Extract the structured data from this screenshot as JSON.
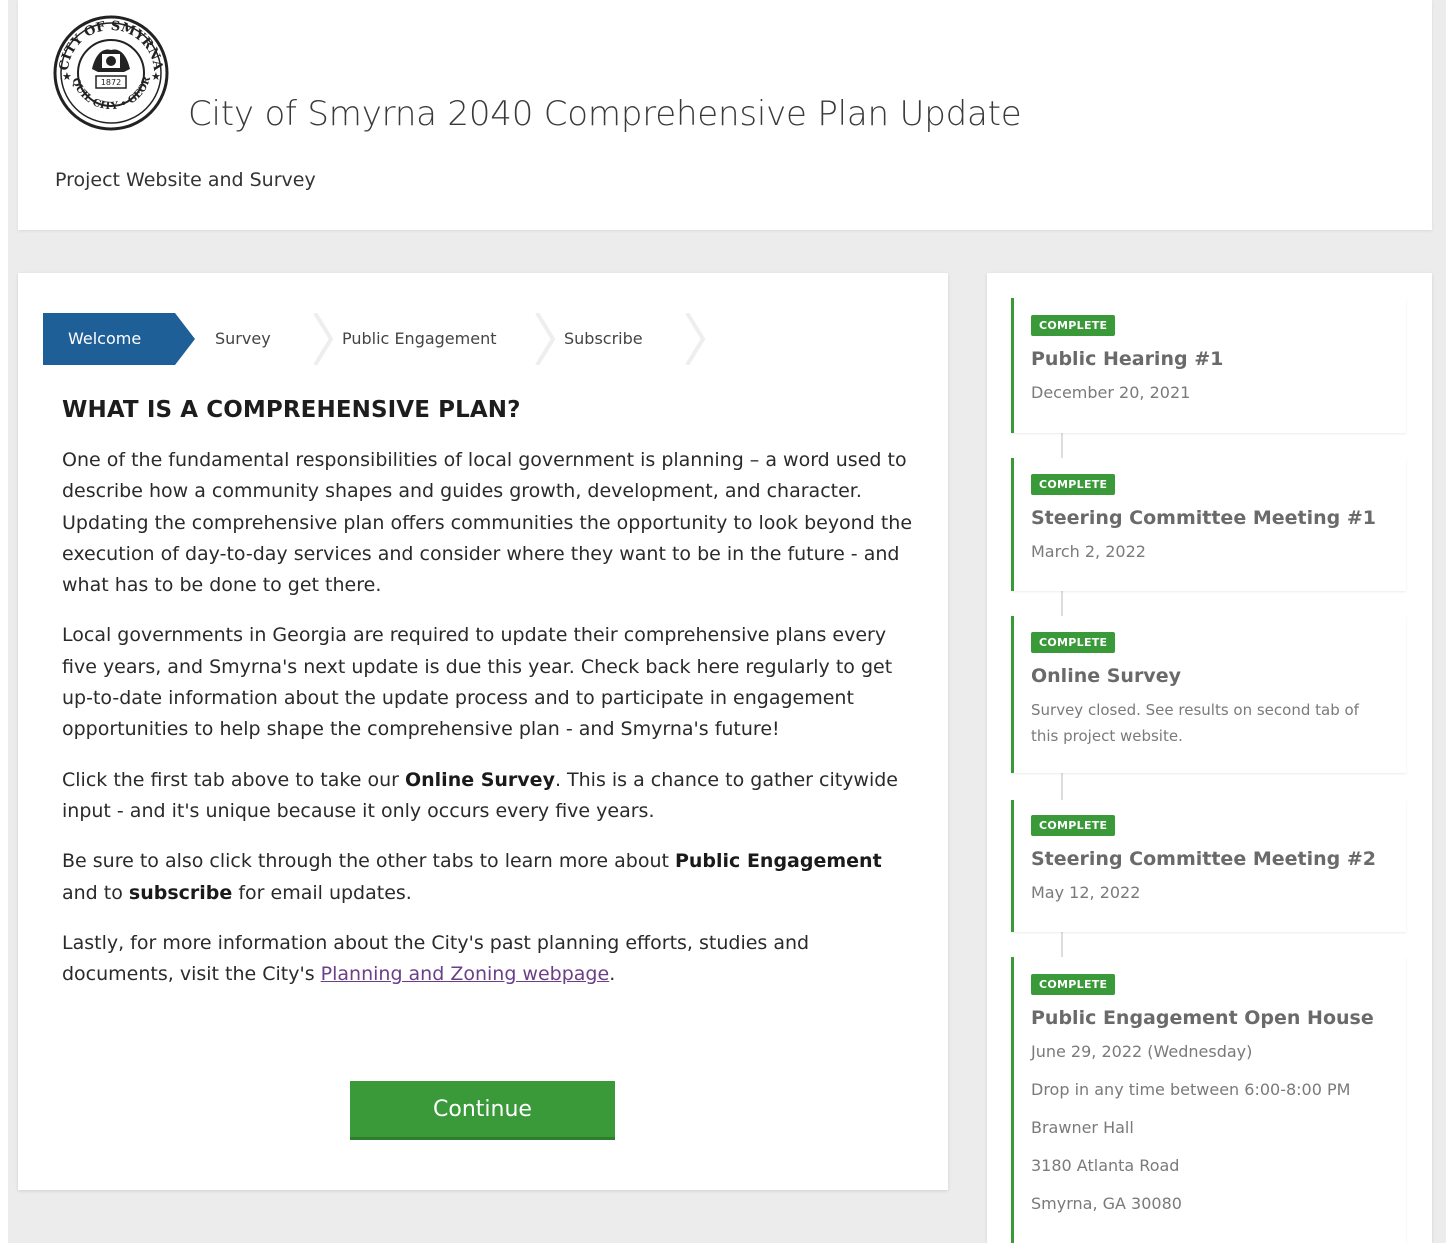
{
  "header": {
    "seal_text": "CITY OF SMYRNA • JONQUIL CITY • GEORGIA • 1872",
    "title": "City of Smyrna 2040 Comprehensive Plan Update",
    "subtitle": "Project Website and Survey"
  },
  "tabs": [
    {
      "label": "Welcome",
      "active": true
    },
    {
      "label": "Survey",
      "active": false
    },
    {
      "label": "Public Engagement",
      "active": false
    },
    {
      "label": "Subscribe",
      "active": false
    }
  ],
  "content": {
    "heading": "WHAT IS A COMPREHENSIVE PLAN?",
    "p1": "One of the fundamental responsibilities of local government is planning – a word used to describe how a community shapes and guides growth, development, and character. Updating the comprehensive plan offers communities the opportunity to look beyond the execution of day-to-day services and consider where they want to be in the future - and what has to be done to get there.",
    "p2": "Local governments in Georgia are required to update their comprehensive plans every five years, and Smyrna's next update is due this year. Check back here regularly to get up-to-date information about the update process and to participate in engagement opportunities to help shape the comprehensive plan - and Smyrna's future!",
    "p3_a": "Click the first tab above to take our ",
    "p3_b": "Online Survey",
    "p3_c": ". This is a chance to gather citywide input - and it's unique because it only occurs every five years.",
    "p4_a": "Be sure to also click through the other tabs to learn more about ",
    "p4_b": "Public Engagement",
    "p4_c": " and to ",
    "p4_d": "subscribe",
    "p4_e": " for email updates.",
    "p5_a": "Lastly, for more information about the City's past planning efforts, studies and documents, visit the City's ",
    "p5_link": "Planning and Zoning webpage",
    "p5_b": "."
  },
  "continue_label": "Continue",
  "timeline": [
    {
      "badge": "COMPLETE",
      "title": "Public Hearing #1",
      "lines": [
        "December 20, 2021"
      ]
    },
    {
      "badge": "COMPLETE",
      "title": "Steering Committee Meeting #1",
      "lines": [
        "March 2, 2022"
      ]
    },
    {
      "badge": "COMPLETE",
      "title": "Online Survey",
      "lines": [
        "Survey closed. See results on second tab of this project website."
      ]
    },
    {
      "badge": "COMPLETE",
      "title": "Steering Committee Meeting #2",
      "lines": [
        "May 12, 2022"
      ]
    },
    {
      "badge": "COMPLETE",
      "title": "Public Engagement Open House",
      "lines": [
        "June 29, 2022 (Wednesday)",
        "Drop in any time between 6:00-8:00 PM",
        "Brawner Hall",
        "3180 Atlanta Road",
        "Smyrna, GA 30080"
      ]
    }
  ],
  "colors": {
    "tab_active": "#1f5f98",
    "accent_green": "#3a9a3a",
    "link": "#6b3f87"
  }
}
